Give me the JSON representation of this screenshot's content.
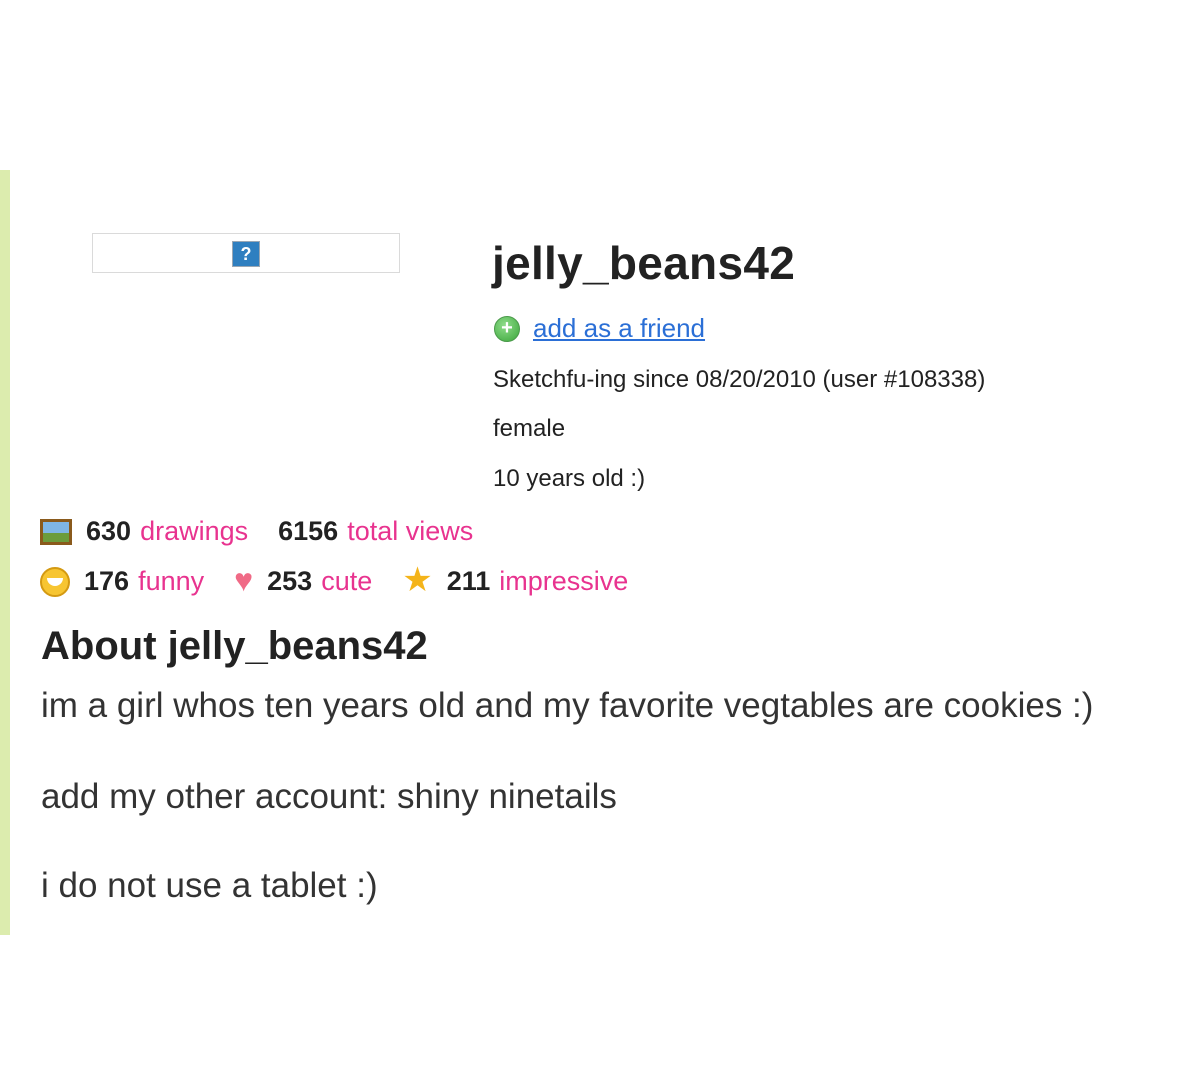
{
  "profile": {
    "username": "jelly_beans42",
    "add_friend_label": "add as a friend",
    "member_since": "Sketchfu-ing since 08/20/2010 (user #108338)",
    "gender": "female",
    "age": "10 years old :)",
    "avatar_placeholder": "?"
  },
  "stats": {
    "drawings_count": "630",
    "drawings_label": "drawings",
    "views_count": "6156",
    "views_label": "total views",
    "funny_count": "176",
    "funny_label": "funny",
    "cute_count": "253",
    "cute_label": "cute",
    "impressive_count": "211",
    "impressive_label": "impressive"
  },
  "about": {
    "title": "About jelly_beans42",
    "lines": [
      "im a girl whos ten years old and my favorite vegtables are cookies :)",
      "add my other account: shiny ninetails",
      "i do not use a tablet :)"
    ]
  },
  "icons": {
    "add_friend": "plus-circle-icon",
    "drawings": "picture-icon",
    "funny": "smile-icon",
    "cute": "heart-icon",
    "impressive": "star-icon",
    "avatar": "question-mark-icon"
  },
  "colors": {
    "stat_label": "#e8338f",
    "link": "#2b6fd6",
    "left_stripe": "#dcecae"
  }
}
